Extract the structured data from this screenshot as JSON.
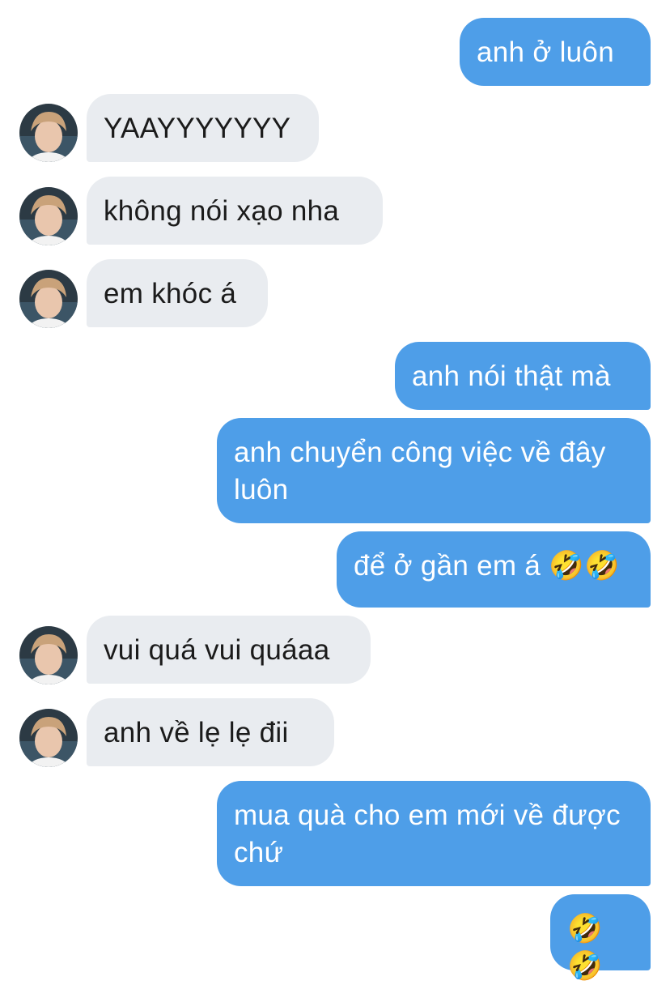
{
  "conversation": {
    "messages": [
      {
        "from": "me",
        "text": "anh ở luôn"
      },
      {
        "from": "them",
        "text": "YAAYYYYYYY"
      },
      {
        "from": "them",
        "text": "không nói xạo nha"
      },
      {
        "from": "them",
        "text": "em khóc á"
      },
      {
        "from": "me",
        "text": "anh nói thật mà"
      },
      {
        "from": "me",
        "text": "anh chuyển công việc về đây luôn"
      },
      {
        "from": "me",
        "text": "để ở gần em á 🤣🤣"
      },
      {
        "from": "them",
        "text": "vui quá vui quáaa"
      },
      {
        "from": "them",
        "text": "anh về lẹ lẹ đii"
      },
      {
        "from": "me",
        "text": "mua quà cho em mới về được chứ"
      },
      {
        "from": "me",
        "text": "🤣🤣"
      }
    ]
  },
  "colors": {
    "outgoing_bubble": "#4e9ee8",
    "incoming_bubble": "#e9ecf0"
  }
}
